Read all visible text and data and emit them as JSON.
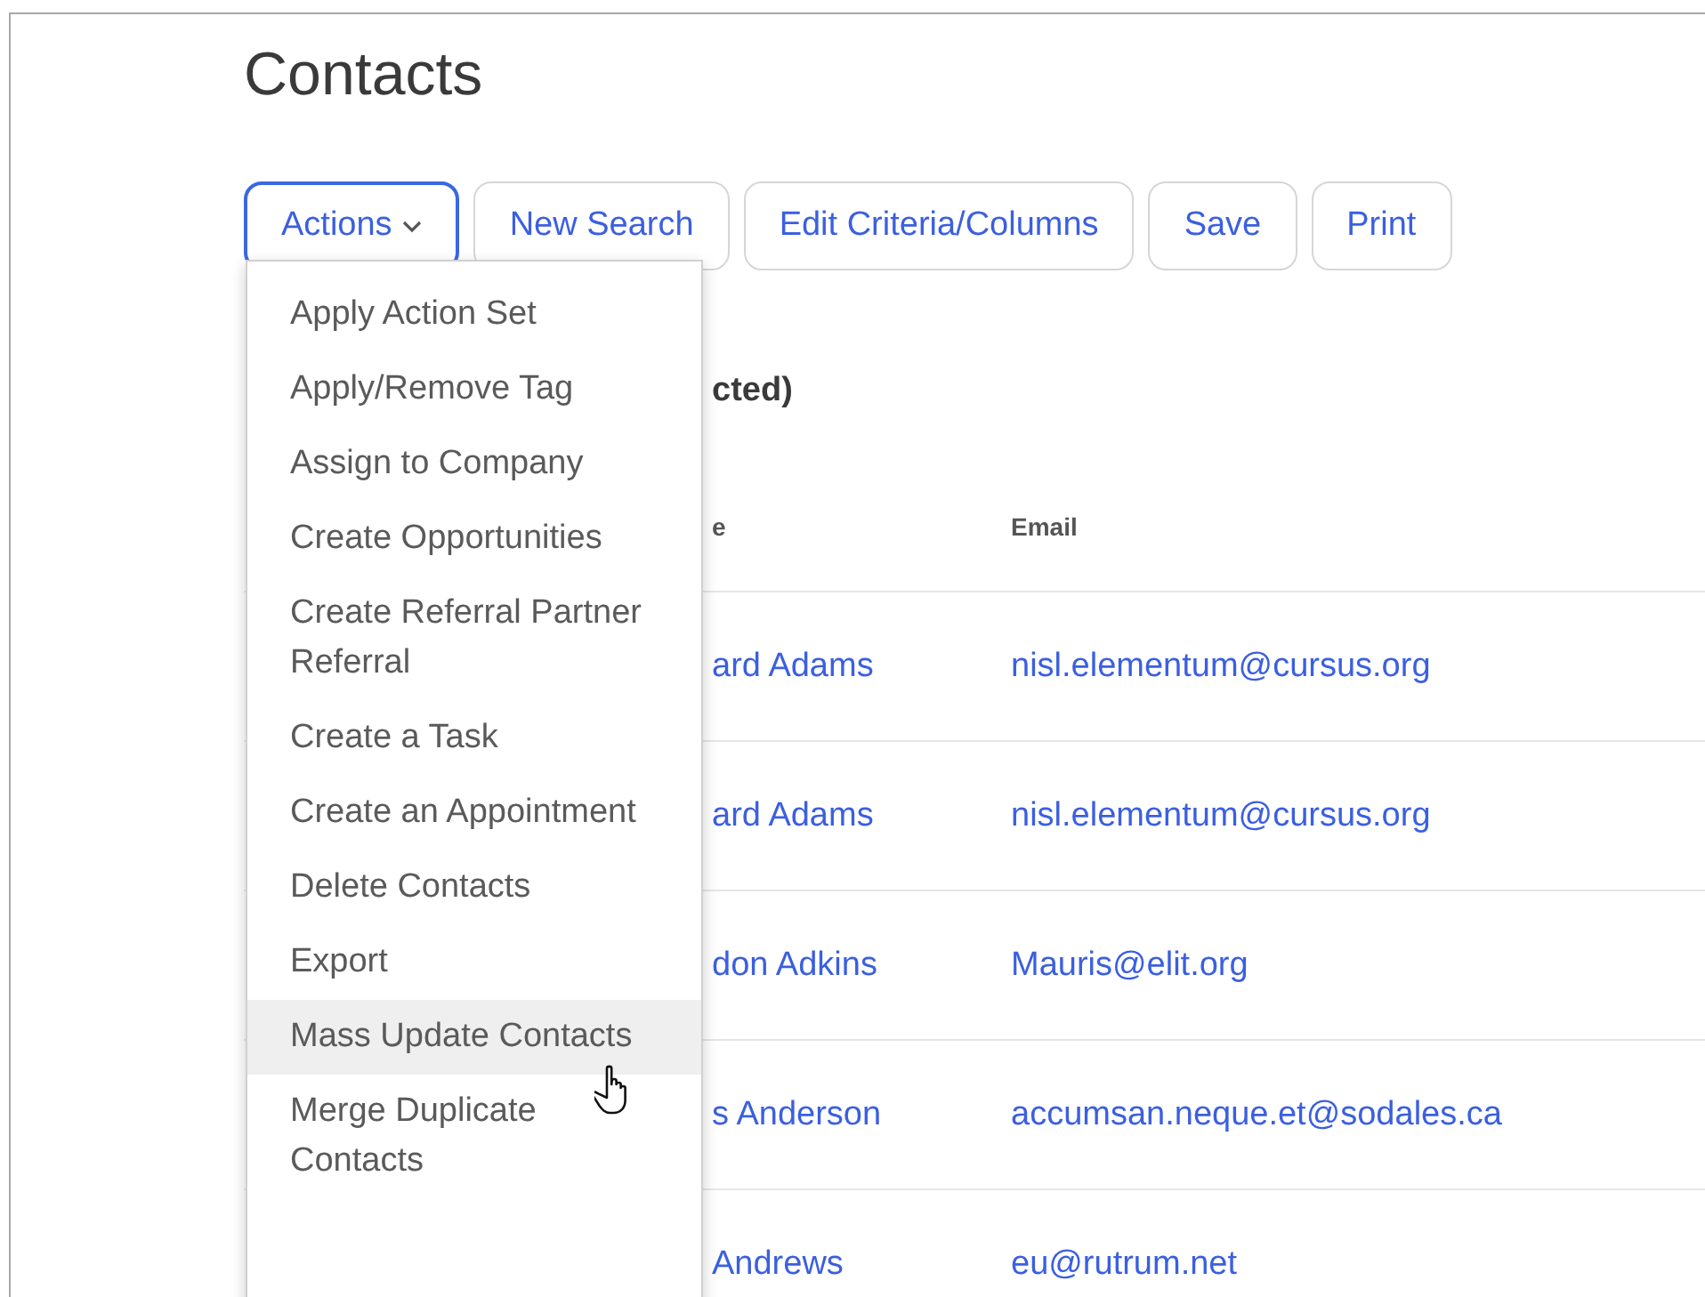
{
  "page": {
    "title": "Contacts"
  },
  "toolbar": [
    {
      "label": "Actions",
      "kind": "dropdown",
      "focused": true
    },
    {
      "label": "New Search",
      "kind": "button",
      "focused": false
    },
    {
      "label": "Edit Criteria/Columns",
      "kind": "button",
      "focused": false
    },
    {
      "label": "Save",
      "kind": "button",
      "focused": false
    },
    {
      "label": "Print",
      "kind": "button",
      "focused": false
    }
  ],
  "actions_menu": {
    "items": [
      {
        "label": "Apply Action Set",
        "highlighted": false
      },
      {
        "label": "Apply/Remove Tag",
        "highlighted": false
      },
      {
        "label": "Assign to Company",
        "highlighted": false
      },
      {
        "label": "Create Opportunities",
        "highlighted": false
      },
      {
        "label": "Create Referral Partner Referral",
        "highlighted": false
      },
      {
        "label": "Create a Task",
        "highlighted": false
      },
      {
        "label": "Create an Appointment",
        "highlighted": false
      },
      {
        "label": "Delete Contacts",
        "highlighted": false
      },
      {
        "label": "Export",
        "highlighted": false
      },
      {
        "label": "Mass Update Contacts",
        "highlighted": true
      },
      {
        "label": "Merge Duplicate Contacts",
        "highlighted": false
      }
    ]
  },
  "results_heading": "cted)",
  "table": {
    "columns": [
      "e",
      "Email"
    ],
    "rows": [
      {
        "name": "ard Adams",
        "email": "nisl.elementum@cursus.org"
      },
      {
        "name": "ard Adams",
        "email": "nisl.elementum@cursus.org"
      },
      {
        "name": "don Adkins",
        "email": "Mauris@elit.org"
      },
      {
        "name": "s Anderson",
        "email": "accumsan.neque.et@sodales.ca"
      },
      {
        "name": "Andrews",
        "email": "eu@rutrum.net"
      }
    ]
  }
}
